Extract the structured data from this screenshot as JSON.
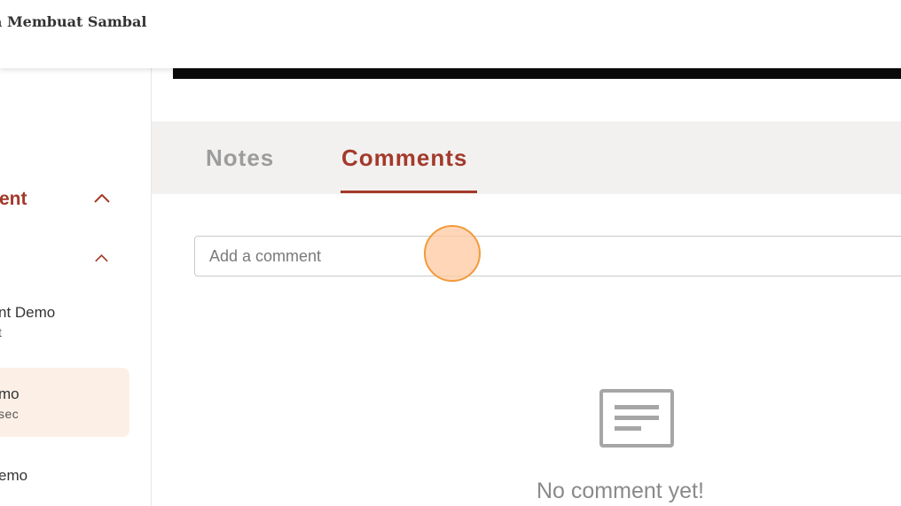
{
  "header": {
    "course_title": "a Membuat Sambal"
  },
  "sidebar": {
    "section_label": "tent",
    "items": [
      {
        "title": "nt Demo",
        "subtitle": "t"
      },
      {
        "title": "mo",
        "subtitle": "sec",
        "active": true
      },
      {
        "title": "emo"
      }
    ]
  },
  "tabs": [
    {
      "label": "Notes",
      "active": false
    },
    {
      "label": "Comments",
      "active": true
    }
  ],
  "comment": {
    "placeholder": "Add a comment",
    "value": ""
  },
  "empty_state": {
    "message": "No comment yet!",
    "icon": "document-lines-icon"
  },
  "colors": {
    "accent": "#a33a2b",
    "active_bg": "#fcf0e6",
    "tab_bar": "#f2f1f0"
  }
}
